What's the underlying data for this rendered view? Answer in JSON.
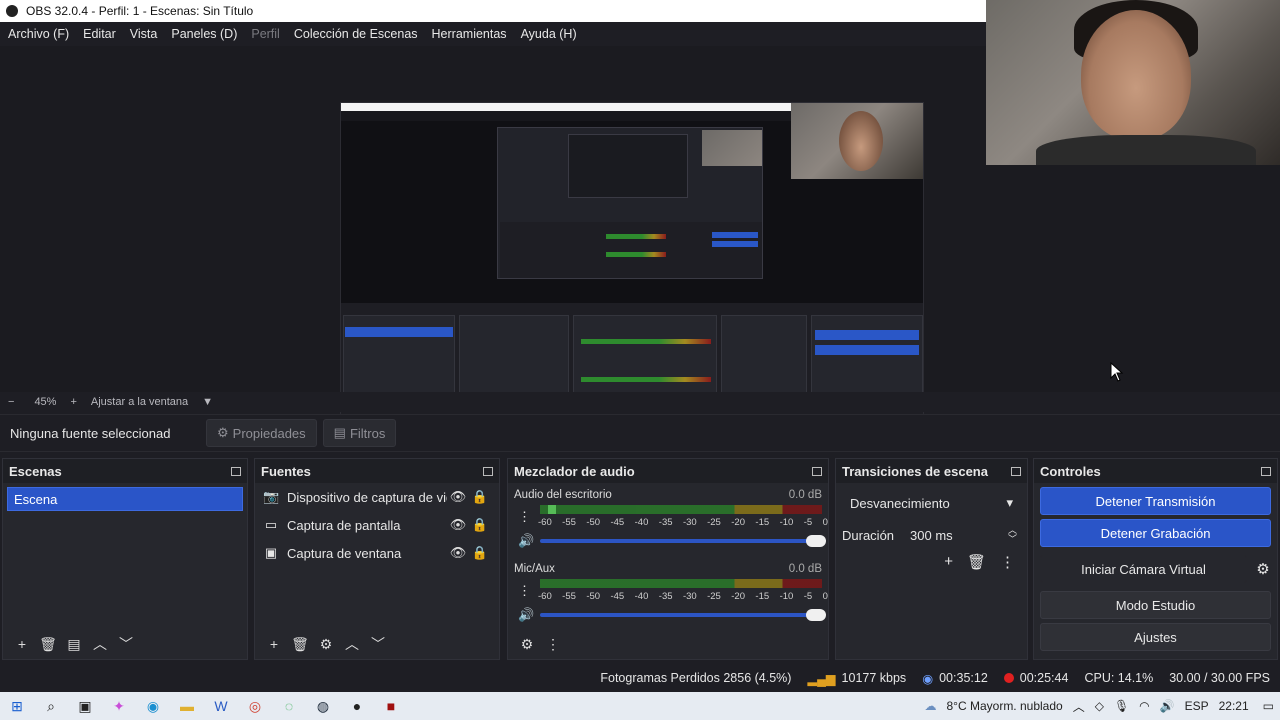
{
  "window": {
    "title": "OBS 32.0.4 - Perfil: 1 - Escenas: Sin Título"
  },
  "menu": [
    {
      "label": "Archivo (F)",
      "disabled": false
    },
    {
      "label": "Editar",
      "disabled": false
    },
    {
      "label": "Vista",
      "disabled": false
    },
    {
      "label": "Paneles (D)",
      "disabled": false
    },
    {
      "label": "Perfil",
      "disabled": true
    },
    {
      "label": "Colección de Escenas",
      "disabled": false
    },
    {
      "label": "Herramientas",
      "disabled": false
    },
    {
      "label": "Ayuda (H)",
      "disabled": false
    }
  ],
  "zoom": {
    "minus": "−",
    "value": "45%",
    "plus": "+",
    "fit_label": "Ajustar a la ventana"
  },
  "source_toolbar": {
    "no_selection": "Ninguna fuente seleccionad",
    "properties": "Propiedades",
    "filters": "Filtros"
  },
  "scenes": {
    "title": "Escenas",
    "items": [
      "Escena"
    ]
  },
  "sources": {
    "title": "Fuentes",
    "items": [
      {
        "name": "Dispositivo de captura de vid",
        "icon": "camera-icon"
      },
      {
        "name": "Captura de pantalla",
        "icon": "monitor-icon"
      },
      {
        "name": "Captura de ventana",
        "icon": "window-icon"
      }
    ]
  },
  "mixer": {
    "title": "Mezclador de audio",
    "ticks": [
      "-60",
      "-55",
      "-50",
      "-45",
      "-40",
      "-35",
      "-30",
      "-25",
      "-20",
      "-15",
      "-10",
      "-5",
      "0"
    ],
    "tracks": [
      {
        "name": "Audio del escritorio",
        "db": "0.0 dB"
      },
      {
        "name": "Mic/Aux",
        "db": "0.0 dB"
      }
    ]
  },
  "transitions": {
    "title": "Transiciones de escena",
    "selected": "Desvanecimiento",
    "duration_label": "Duración",
    "duration_value": "300 ms"
  },
  "controls": {
    "title": "Controles",
    "stop_stream": "Detener Transmisión",
    "stop_recording": "Detener Grabación",
    "virtual_cam": "Iniciar Cámara Virtual",
    "studio_mode": "Modo Estudio",
    "settings": "Ajustes"
  },
  "status": {
    "dropped": "Fotogramas Perdidos 2856 (4.5%)",
    "bitrate": "10177 kbps",
    "stream_time": "00:35:12",
    "rec_time": "00:25:44",
    "cpu": "CPU: 14.1%",
    "fps": "30.00 / 30.00 FPS"
  },
  "taskbar": {
    "weather": "8°C  Mayorm. nublado",
    "lang": "ESP",
    "time": "22:21"
  },
  "colors": {
    "accent": "#2a55c8",
    "rec": "#e02020"
  }
}
